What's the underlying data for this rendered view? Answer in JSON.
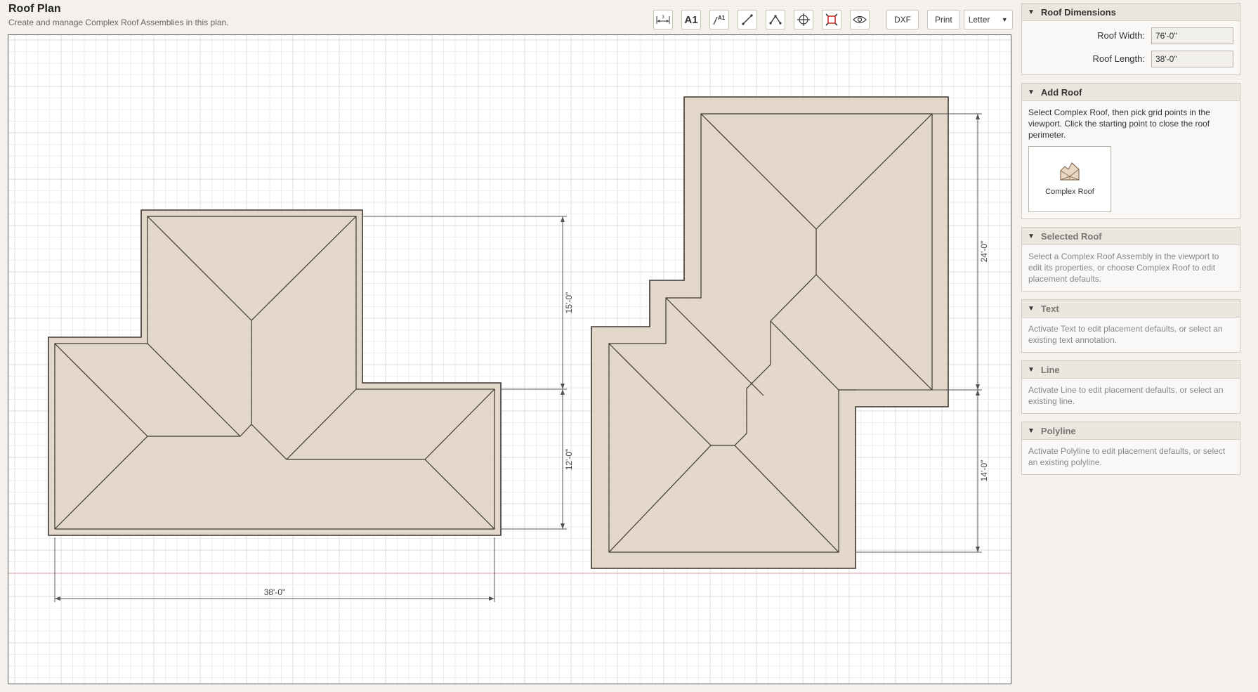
{
  "header": {
    "title": "Roof Plan",
    "subtitle": "Create and manage Complex Roof Assemblies in this plan."
  },
  "toolbar": {
    "tools": [
      {
        "name": "dimension-tool",
        "icon": "dimension-icon"
      },
      {
        "name": "text-tool",
        "icon": "text-a1-icon",
        "label": "A1"
      },
      {
        "name": "leader-text-tool",
        "icon": "leader-text-icon"
      },
      {
        "name": "line-tool",
        "icon": "line-icon"
      },
      {
        "name": "polyline-tool",
        "icon": "polyline-icon"
      },
      {
        "name": "pan-tool",
        "icon": "move-icon"
      },
      {
        "name": "zoom-extents-tool",
        "icon": "zoom-extents-icon"
      },
      {
        "name": "visibility-tool",
        "icon": "eye-icon"
      }
    ],
    "dxf_label": "DXF",
    "print_label": "Print",
    "paper_size": "Letter",
    "paper_arrow": "▼"
  },
  "viewport": {
    "dimensions": {
      "roof1_width": "38'-0\"",
      "roof1_upper": "15'-0\"",
      "roof1_lower": "12'-0\"",
      "roof2_upper": "24'-0\"",
      "roof2_lower": "14'-0\""
    }
  },
  "panels": {
    "roof_dimensions": {
      "title": "Roof Dimensions",
      "width_label": "Roof Width:",
      "width_value": "76'-0\"",
      "length_label": "Roof Length:",
      "length_value": "38'-0\""
    },
    "add_roof": {
      "title": "Add Roof",
      "description": "Select Complex Roof, then pick grid points in the viewport. Click the starting point to close the roof perimeter.",
      "button_label": "Complex Roof"
    },
    "selected_roof": {
      "title": "Selected Roof",
      "description": "Select a Complex Roof Assembly in the viewport to edit its properties, or choose Complex Roof to edit placement defaults."
    },
    "text": {
      "title": "Text",
      "description": "Activate Text to edit placement defaults, or select an existing text annotation."
    },
    "line": {
      "title": "Line",
      "description": "Activate Line to edit placement defaults, or select an existing line."
    },
    "polyline": {
      "title": "Polyline",
      "description": "Activate Polyline to edit placement defaults, or select an existing polyline."
    },
    "caret": "▼"
  },
  "colors": {
    "roof_fill": "#dfd3c3",
    "roof_stroke": "#3d3530",
    "grid_line": "#e6e6e6",
    "baseline": "#d4a59a",
    "dim_line": "#555555"
  }
}
